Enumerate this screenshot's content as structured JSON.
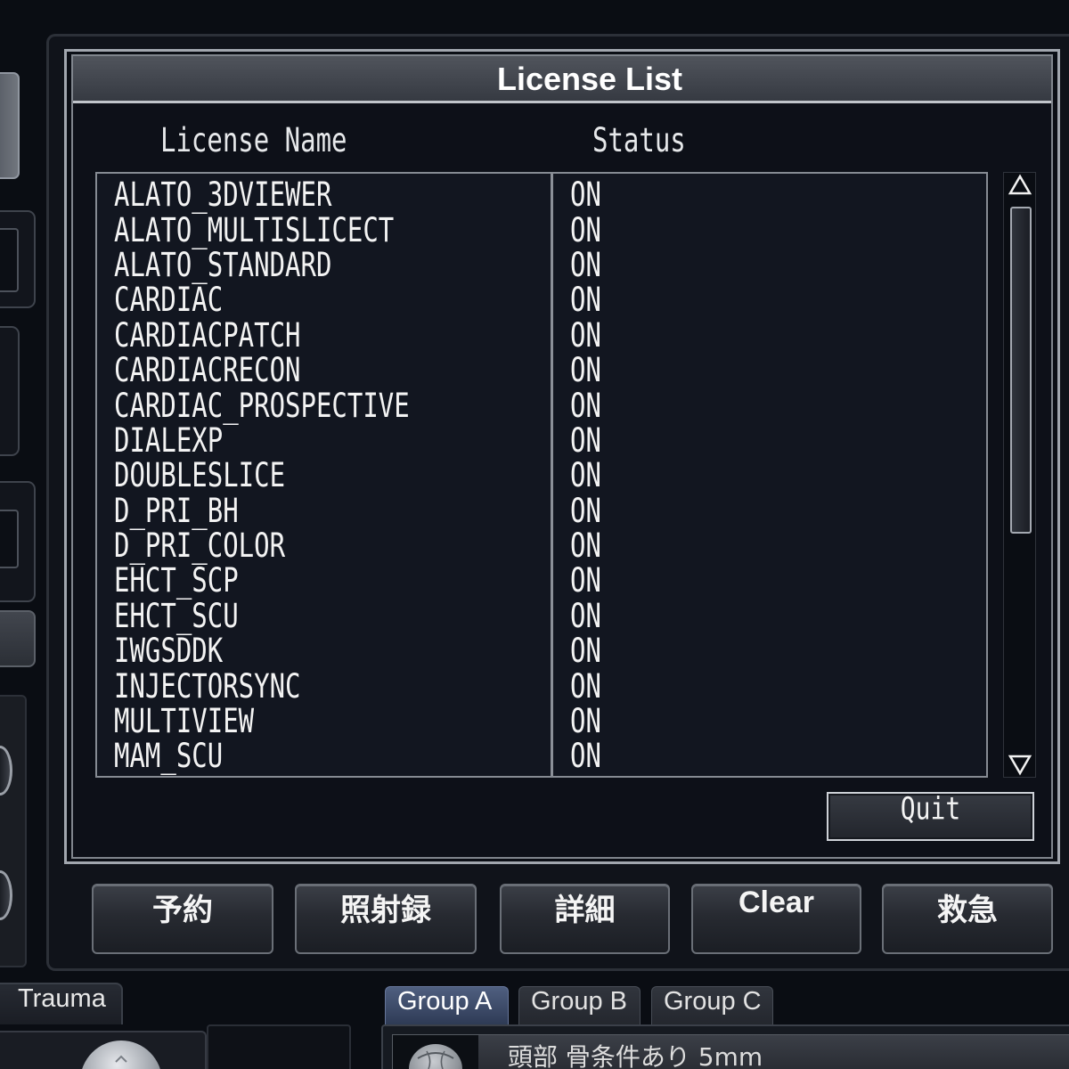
{
  "theme": {
    "background": "#0a0d13",
    "dialog_background": "#0d1018",
    "text": "#f3f3f3",
    "selected_tab": "#4f5f80"
  },
  "dialog": {
    "title": "License List",
    "columns": {
      "name": "License Name",
      "status": "Status"
    },
    "licenses": [
      {
        "name": "ALATO_3DVIEWER",
        "status": "ON"
      },
      {
        "name": "ALATO_MULTISLICECT",
        "status": "ON"
      },
      {
        "name": "ALATO_STANDARD",
        "status": "ON"
      },
      {
        "name": "CARDIAC",
        "status": "ON"
      },
      {
        "name": "CARDIACPATCH",
        "status": "ON"
      },
      {
        "name": "CARDIACRECON",
        "status": "ON"
      },
      {
        "name": "CARDIAC_PROSPECTIVE",
        "status": "ON"
      },
      {
        "name": "DIALEXP",
        "status": "ON"
      },
      {
        "name": "DOUBLESLICE",
        "status": "ON"
      },
      {
        "name": "D_PRI_BH",
        "status": "ON"
      },
      {
        "name": "D_PRI_COLOR",
        "status": "ON"
      },
      {
        "name": "EHCT_SCP",
        "status": "ON"
      },
      {
        "name": "EHCT_SCU",
        "status": "ON"
      },
      {
        "name": "IWGSDDK",
        "status": "ON"
      },
      {
        "name": "INJECTORSYNC",
        "status": "ON"
      },
      {
        "name": "MULTIVIEW",
        "status": "ON"
      },
      {
        "name": "MAM_SCU",
        "status": "ON"
      }
    ],
    "scrollbar": {
      "position": 0,
      "visible_fraction": 0.6,
      "up_icon": "scroll-up-icon",
      "down_icon": "scroll-down-icon"
    },
    "quit_label": "Quit"
  },
  "action_buttons": [
    {
      "label": "予約"
    },
    {
      "label": "照射録"
    },
    {
      "label": "詳細"
    },
    {
      "label": "Clear"
    },
    {
      "label": "救急"
    }
  ],
  "bottom": {
    "trauma_tab": "Trauma",
    "group_tabs": [
      {
        "label": "Group A",
        "selected": true
      },
      {
        "label": "Group B",
        "selected": false
      },
      {
        "label": "Group C",
        "selected": false
      }
    ],
    "protocol_item": {
      "icon": "head-icon",
      "label": "頭部 骨条件あり 5mm"
    }
  }
}
